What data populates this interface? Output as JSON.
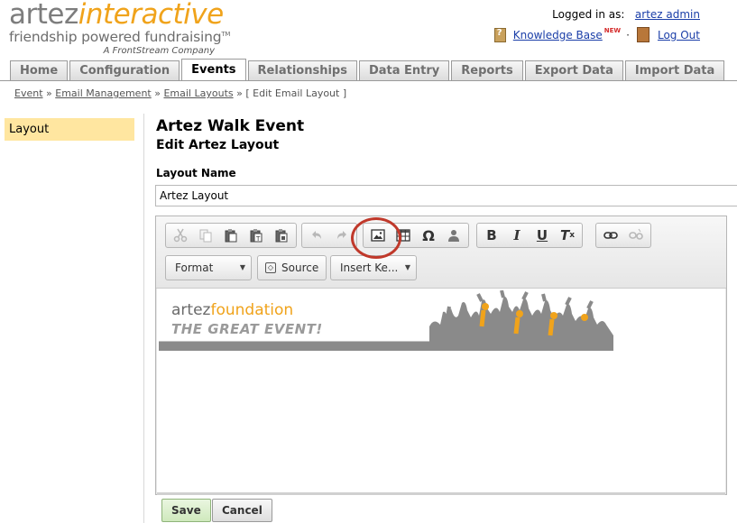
{
  "header": {
    "logo_part1": "artez",
    "logo_part2": "interactive",
    "tagline": "friendship powered fundraising",
    "tm": "TM",
    "company": "A FrontStream Company",
    "logged_in_label": "Logged in as:",
    "user": "artez admin",
    "knowledge_base": "Knowledge Base",
    "new_badge": "NEW",
    "separator": "·",
    "logout": "Log Out"
  },
  "tabs": [
    {
      "label": "Home"
    },
    {
      "label": "Configuration"
    },
    {
      "label": "Events",
      "active": true
    },
    {
      "label": "Relationships"
    },
    {
      "label": "Data Entry"
    },
    {
      "label": "Reports"
    },
    {
      "label": "Export Data"
    },
    {
      "label": "Import Data"
    }
  ],
  "breadcrumb": {
    "items": [
      "Event",
      "Email Management",
      "Email Layouts"
    ],
    "sep": "»",
    "current": "[ Edit Email Layout ]"
  },
  "sidebar": {
    "items": [
      {
        "label": "Layout",
        "selected": true
      }
    ]
  },
  "main": {
    "event_title": "Artez Walk Event",
    "subtitle": "Edit Artez Layout",
    "layout_name_label": "Layout Name",
    "layout_name_value": "Artez Layout"
  },
  "editor": {
    "toolbar": {
      "format_label": "Format",
      "source_label": "Source",
      "insert_label": "Insert Ke...",
      "icons": [
        "cut-icon",
        "copy-icon",
        "paste-icon",
        "paste-text-icon",
        "paste-word-icon",
        "undo-icon",
        "redo-icon",
        "image-icon",
        "table-icon",
        "special-char-icon",
        "user-icon",
        "bold-icon",
        "italic-icon",
        "underline-icon",
        "remove-format-icon",
        "link-icon",
        "unlink-icon"
      ]
    },
    "banner": {
      "logo_part1": "artez",
      "logo_part2": "foundation",
      "tagline": "THE GREAT EVENT!"
    }
  },
  "buttons": {
    "save": "Save",
    "cancel": "Cancel"
  },
  "colors": {
    "brand_orange": "#f0a31b",
    "highlight_ring": "#c0392b",
    "sidebar_selected": "#ffe6a0",
    "link": "#1a3ea8"
  }
}
